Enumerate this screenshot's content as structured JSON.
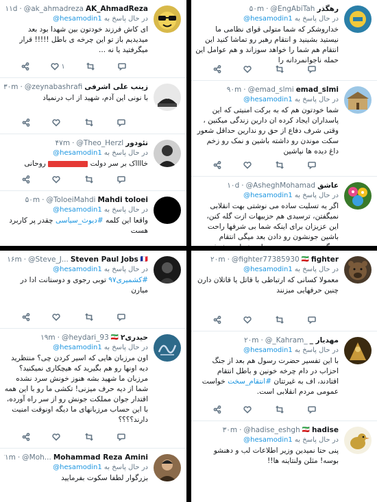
{
  "replying_prefix": "در حال پاسخ به",
  "replying_mention": "@hesamodin1",
  "tweets": {
    "t0": {
      "name": "AK_AhmadReza",
      "handle": "@ak_ahmadreza",
      "time": "۱۱d",
      "body": "ای کاش فرزند خودتون بین شهدا بود بعد میدیدیم باز تو این چرخه ی باطل !!!!! قرار میگرفتید یا نه ...",
      "reply": "",
      "retweet": "",
      "like": "۱",
      "avatar_icon": "sunglasses-avatar-icon"
    },
    "t1": {
      "name": "زینب علی اشرفی",
      "handle": "@zeynabashrafi",
      "time": "۳۰m",
      "body": "با نونی این آدم، شهید از اب درنمیاد",
      "reply": "",
      "retweet": "",
      "like": "",
      "avatar_icon": "cat-avatar-icon"
    },
    "t2": {
      "name": "تئودور",
      "handle": "@Theo_Herzl",
      "time": "۴۷m",
      "body_pre": "خااااک بر سر دولت",
      "body_post": "روحانی",
      "reply": "",
      "retweet": "",
      "like": "",
      "avatar_icon": "portrait-avatar-icon"
    },
    "t3": {
      "name": "Mahdi toloei",
      "handle": "@ToloeiMahdi",
      "time": "۵۰m",
      "body_pre": "واقعا این کلمه",
      "hashtag": "#دیوث_سیاسی",
      "body_post": "چقدر پر کاربرد هست",
      "reply": "",
      "retweet": "",
      "like": "",
      "avatar_icon": "black-avatar-icon"
    },
    "t4": {
      "name": "رهگذر",
      "handle": "@EngAbiTah",
      "time": "۵۰m",
      "body": "خداروشکر که شما متولی قوای نظامی ما نیستید بشینید و انتقام رهبر رو تماشا کنید این انتقام هم شما را خواهد سوزاند و هم عوامل این حمله ناجوانمردانه را",
      "reply": "",
      "retweet": "",
      "like": "",
      "avatar_icon": "logo-avatar-icon"
    },
    "t5": {
      "name": "emad_slmi",
      "handle": "@emad_slmi",
      "time": "۹۰m",
      "body": "شما خودتون هم که به برکت امنیتی که این پاسداران ایجاد کرده ان دارین زندگی میکنین ، وقتی شرف دفاع از حق رو ندارین حداقل شعور سکت موندن رو داشته باشین و نمک رو زخم داغ دیده ها نپاشین",
      "reply": "",
      "retweet": "",
      "like": "",
      "avatar_icon": "building-avatar-icon"
    },
    "t6": {
      "name": "عاشق",
      "handle": "@AsheghMohamad",
      "time": "۱۰d",
      "body": "اگر یه تسلیت ساده می نوشتی بهت انقلابی نمیگفتن، ترسیدی هم حزبیهات ازت گله کنن، این عزیزان برای اینکه شما بی شرفها راحت باشین جونشون رو دادن بعد میگی انتقام نمیگیریم و دیه میدیم و تمام، شما بی شرفی رو به نهایت رسوندین و حد یقفی هم ندارین،",
      "reply": "",
      "retweet": "",
      "like": "",
      "avatar_icon": "flowers-avatar-icon"
    },
    "t7": {
      "name": "Steven Paul Jobs",
      "handle": "@Steve_J...",
      "time": "۱۶m",
      "body_hashtag": "#کشمیری۹۷",
      "body_post": "توبی رجوی و دوستانت ادا در میارن",
      "reply": "",
      "retweet": "",
      "like": "",
      "avatar_icon": "dark-portrait-avatar-icon"
    },
    "t8": {
      "name": "حیدری۲",
      "handle": "@heydari_93",
      "time": "۱۹m",
      "body": "اون مرزبان هایی که اسیر کردن چی؟ منتظرید دیه اونها رو هم بگیرید که هیچکاری نمیکنید؟ مرزبان ما شهید بشه هنوز خونش سرد نشده شما از دیه حرف میزنی! تکشی ما رو با این همه اقتدار جوان مملکت جونش رو از سر راه آورده، با این حساب مرزبانهای ما دیگه اونوقت امنیت دارند؟؟؟؟",
      "reply": "",
      "retweet": "",
      "like": "",
      "avatar_icon": "calligraphy-avatar-icon"
    },
    "t9": {
      "name": "Mohammad Reza Amini",
      "handle": "@Moh...",
      "time": "۲۱m",
      "body": "بزرگوار لطفا سکوت بفرمایید",
      "reply": "",
      "retweet": "",
      "like": "",
      "avatar_icon": "man-avatar-icon"
    },
    "t10": {
      "name": "fighter",
      "handle": "@fighter77385930",
      "time": "۲۰m",
      "body": "معمولا کسانی که ارتباطی با قاتل یا قاتلان دارن چنین حرفهایی میزنند",
      "reply": "",
      "retweet": "",
      "like": "",
      "avatar_icon": "bear-avatar-icon"
    },
    "t11": {
      "name": "مهدیار _",
      "handle": "@_Kahram_",
      "time": "۲۰m",
      "body_pre": "با این تفسیر حضرت رسول هم بعد از جنگ احزاب در دام چرخه خونین و باطل انتقام افتادند، اف به غیرتتان",
      "hashtag": "#انتقام_سخت",
      "body_post": "خواست عمومی مردم انقلابی است.",
      "reply": "",
      "retweet": "",
      "like": "",
      "avatar_icon": "painting-avatar-icon"
    },
    "t12": {
      "name": "hadise",
      "handle": "@hadise_eshgh",
      "time": "۳۰m",
      "body": "پنی حتا نمیدین وزیر اطلاعات لب و دهنشو بوسه! مثلن ولنتاینه ها!!",
      "reply": "",
      "retweet": "",
      "like": "",
      "avatar_icon": "bird-avatar-icon"
    }
  },
  "colors": {
    "link": "#1b95e0",
    "text": "#14171a",
    "muted": "#657786",
    "divider": "#000000"
  }
}
